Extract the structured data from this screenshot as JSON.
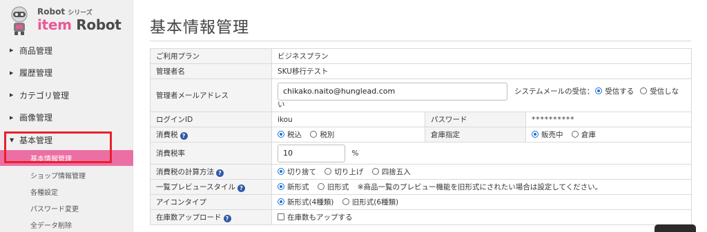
{
  "logo": {
    "series_prefix": "Robot",
    "series_suffix": "シリーズ",
    "brand_item": "item",
    "brand_robot": "Robot"
  },
  "nav": {
    "items": [
      {
        "label": "商品管理"
      },
      {
        "label": "履歴管理"
      },
      {
        "label": "カテゴリ管理"
      },
      {
        "label": "画像管理"
      },
      {
        "label": "基本管理"
      }
    ],
    "sub_items": [
      {
        "label": "基本情報管理"
      },
      {
        "label": "ショップ情報管理"
      },
      {
        "label": "各種設定"
      },
      {
        "label": "パスワード変更"
      },
      {
        "label": "全データ削除"
      }
    ]
  },
  "page": {
    "title": "基本情報管理"
  },
  "form": {
    "plan": {
      "label": "ご利用プラン",
      "value": "ビジネスプラン"
    },
    "admin_name": {
      "label": "管理者名",
      "value": "SKU移行テスト"
    },
    "admin_email": {
      "label": "管理者メールアドレス",
      "value": "chikako.naito@hunglead.com",
      "system_mail_label": "システムメールの受信：",
      "opt_receive": "受信する",
      "opt_no_receive_1": "受信しな",
      "opt_no_receive_2": "い"
    },
    "login_id": {
      "label": "ログインID",
      "value": "ikou"
    },
    "password": {
      "label": "パスワード",
      "value": "**********"
    },
    "tax": {
      "label": "消費税",
      "opt_incl": "税込",
      "opt_excl": "税別"
    },
    "warehouse": {
      "label": "倉庫指定",
      "opt_sale": "販売中",
      "opt_storage": "倉庫"
    },
    "tax_rate": {
      "label": "消費税率",
      "value": "10",
      "unit": "%"
    },
    "tax_calc": {
      "label": "消費税の計算方法",
      "opt_floor": "切り捨て",
      "opt_ceil": "切り上げ",
      "opt_round": "四捨五入"
    },
    "preview_style": {
      "label": "一覧プレビュースタイル",
      "opt_new": "新形式",
      "opt_old": "旧形式",
      "note": "※商品一覧のプレビュー機能を旧形式にされたい場合は設定してください。"
    },
    "icon_type": {
      "label": "アイコンタイプ",
      "opt_new": "新形式(4種類)",
      "opt_old": "旧形式(6種類)"
    },
    "stock_upload": {
      "label": "在庫数アップロード",
      "opt": "在庫数もアップする"
    }
  },
  "colors": {
    "accent_pink": "#ec6fa3",
    "highlight_red": "#e8202c",
    "radio_blue": "#1a6fd8",
    "help_blue": "#2f5aa8"
  }
}
